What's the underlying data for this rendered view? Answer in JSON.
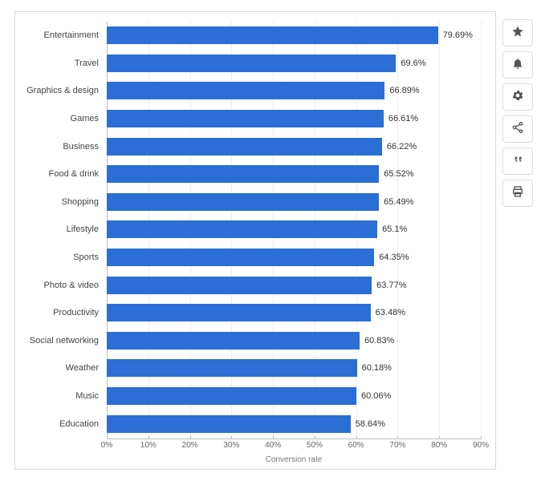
{
  "chart_data": {
    "type": "bar",
    "orientation": "horizontal",
    "categories": [
      "Entertainment",
      "Travel",
      "Graphics & design",
      "Games",
      "Business",
      "Food & drink",
      "Shopping",
      "Lifestyle",
      "Sports",
      "Photo & video",
      "Productivity",
      "Social networking",
      "Weather",
      "Music",
      "Education"
    ],
    "values": [
      79.69,
      69.6,
      66.89,
      66.61,
      66.22,
      65.52,
      65.49,
      65.1,
      64.35,
      63.77,
      63.48,
      60.83,
      60.18,
      60.06,
      58.64
    ],
    "value_labels": [
      "79.69%",
      "69.6%",
      "66.89%",
      "66.61%",
      "66.22%",
      "65.52%",
      "65.49%",
      "65.1%",
      "64.35%",
      "63.77%",
      "63.48%",
      "60.83%",
      "60.18%",
      "60.06%",
      "58.64%"
    ],
    "xlabel": "Conversion rate",
    "xticks": [
      "0%",
      "10%",
      "20%",
      "30%",
      "40%",
      "50%",
      "60%",
      "70%",
      "80%",
      "90%"
    ],
    "xlim": [
      0,
      90
    ],
    "bar_color": "#2a6ed6"
  },
  "actions": {
    "favorite": "Favorite",
    "alert": "Alert",
    "settings": "Settings",
    "share": "Share",
    "cite": "Cite",
    "print": "Print"
  }
}
